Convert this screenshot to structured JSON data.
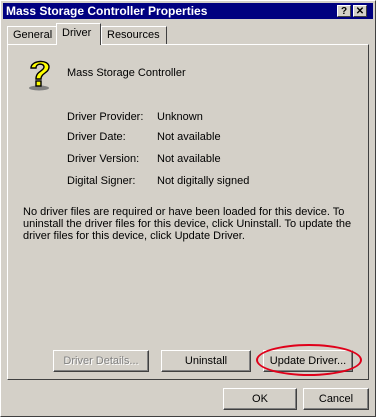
{
  "window": {
    "title": "Mass Storage Controller Properties",
    "help_button": "?",
    "close_button": "✕"
  },
  "tabs": [
    {
      "label": "General",
      "active": false
    },
    {
      "label": "Driver",
      "active": true
    },
    {
      "label": "Resources",
      "active": false
    }
  ],
  "device": {
    "icon": "unknown-device-question-icon",
    "name": "Mass Storage Controller"
  },
  "properties": [
    {
      "label": "Driver Provider:",
      "value": "Unknown"
    },
    {
      "label": "Driver Date:",
      "value": "Not available"
    },
    {
      "label": "Driver Version:",
      "value": "Not available"
    },
    {
      "label": "Digital Signer:",
      "value": "Not digitally signed"
    }
  ],
  "description": "No driver files are required or have been loaded for this device. To uninstall the driver files for this device, click Uninstall. To update the driver files for this device, click Update Driver.",
  "buttons": {
    "driver_details": "Driver Details...",
    "uninstall": "Uninstall",
    "update_driver": "Update Driver...",
    "ok": "OK",
    "cancel": "Cancel"
  },
  "colors": {
    "titlebar": "#000080",
    "highlight": "#e0001a",
    "face": "#d4d0c8"
  }
}
